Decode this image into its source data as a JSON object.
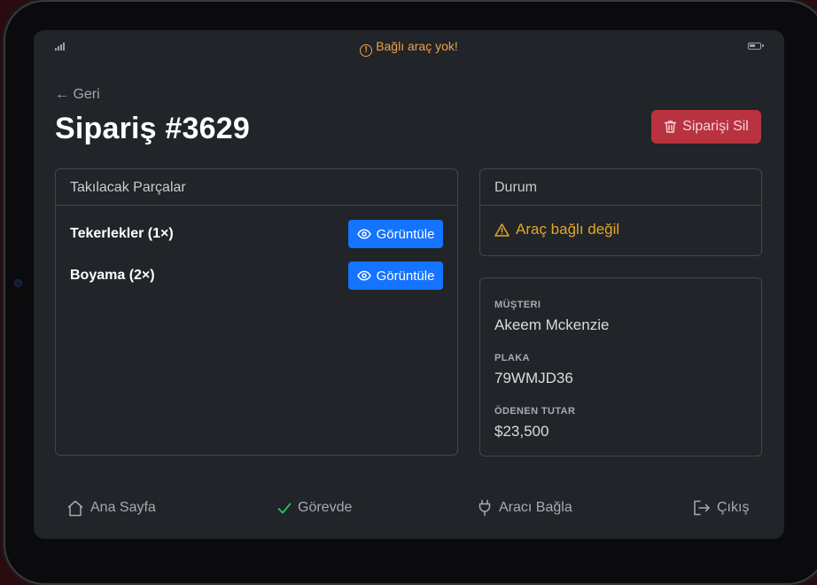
{
  "status_bar": {
    "alert_text": "Bağlı araç yok!",
    "alert_icon": "alert-circle-icon",
    "alert_color": "#f0a04b"
  },
  "header": {
    "back_label": "← Geri",
    "title": "Sipariş #3629",
    "delete_label": "Siparişi Sil",
    "delete_color": "#b8323f"
  },
  "parts": {
    "title": "Takılacak Parçalar",
    "view_label": "Görüntüle",
    "button_color": "#1473ff",
    "items": [
      {
        "name": "Tekerlekler (1×)"
      },
      {
        "name": "Boyama (2×)"
      }
    ]
  },
  "status": {
    "title": "Durum",
    "message": "Araç bağlı değil",
    "color": "#e2a72a"
  },
  "customer": {
    "customer_label": "MÜŞTERI",
    "customer_value": "Akeem Mckenzie",
    "plate_label": "PLAKA",
    "plate_value": "79WMJD36",
    "paid_label": "ÖDENEN TUTAR",
    "paid_value": "$23,500"
  },
  "nav": {
    "home": "Ana Sayfa",
    "on_duty": "Görevde",
    "connect_vehicle": "Aracı Bağla",
    "logout": "Çıkış",
    "on_duty_color": "#22c55e"
  }
}
